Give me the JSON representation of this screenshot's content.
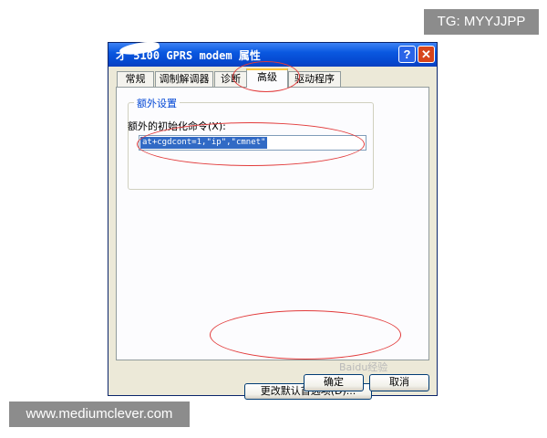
{
  "watermarks": {
    "tg": "TG: MYYJJPP",
    "site": "www.mediumclever.com",
    "corner": "Baidu经验"
  },
  "window": {
    "title": "才 5100 GPRS modem 属性",
    "help_button": "?",
    "close_button": "✕"
  },
  "tabs": [
    {
      "label": "常规"
    },
    {
      "label": "调制解调器"
    },
    {
      "label": "诊断"
    },
    {
      "label": "高级",
      "active": true
    },
    {
      "label": "驱动程序"
    }
  ],
  "advanced": {
    "group_title": "额外设置",
    "init_label": "额外的初始化命令(X):",
    "init_value": "at+cgdcont=1,\"ip\",\"cmnet\""
  },
  "buttons": {
    "restore_defaults": "更改默认首选项(D)...",
    "ok": "确定",
    "cancel": "取消"
  },
  "colors": {
    "titlebar": "#0a58e0",
    "annotation": "#e23b3b",
    "selection": "#316ac5"
  }
}
